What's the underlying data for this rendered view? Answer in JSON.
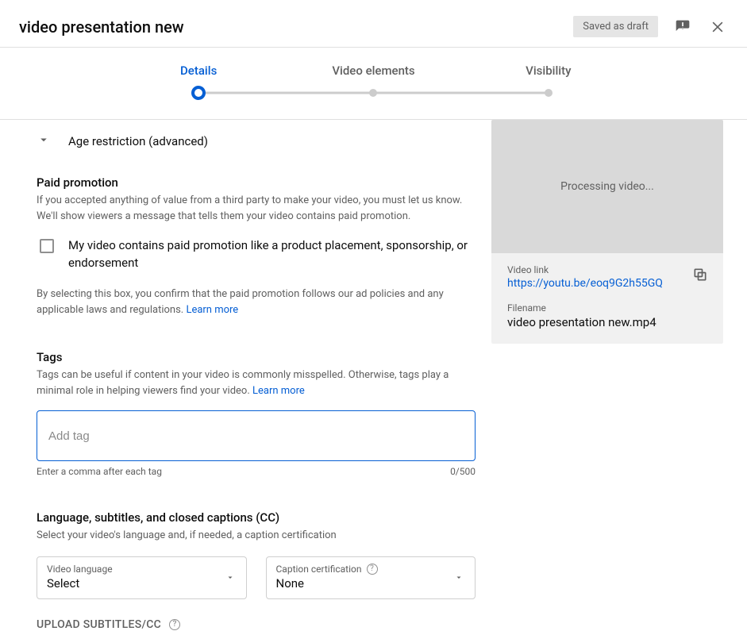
{
  "header": {
    "title": "video presentation new",
    "draft_chip": "Saved as draft"
  },
  "stepper": {
    "steps": [
      {
        "label": "Details"
      },
      {
        "label": "Video elements"
      },
      {
        "label": "Visibility"
      }
    ]
  },
  "age_restriction": {
    "title": "Age restriction (advanced)"
  },
  "paid_promo": {
    "title": "Paid promotion",
    "desc": "If you accepted anything of value from a third party to make your video, you must let us know. We'll show viewers a message that tells them your video contains paid promotion.",
    "checkbox_label": "My video contains paid promotion like a product placement, sponsorship, or endorsement",
    "disclaimer": "By selecting this box, you confirm that the paid promotion follows our ad policies and any applicable laws and regulations. ",
    "learn_more": "Learn more"
  },
  "tags": {
    "title": "Tags",
    "desc": "Tags can be useful if content in your video is commonly misspelled. Otherwise, tags play a minimal role in helping viewers find your video. ",
    "learn_more": "Learn more",
    "placeholder": "Add tag",
    "hint": "Enter a comma after each tag",
    "counter": "0/500"
  },
  "language": {
    "title": "Language, subtitles, and closed captions (CC)",
    "desc": "Select your video's language and, if needed, a caption certification",
    "video_lang_label": "Video language",
    "video_lang_value": "Select",
    "caption_label": "Caption certification",
    "caption_value": "None",
    "upload_btn": "UPLOAD SUBTITLES/CC"
  },
  "side": {
    "processing": "Processing video...",
    "link_label": "Video link",
    "link_value": "https://youtu.be/eoq9G2h55GQ",
    "file_label": "Filename",
    "file_value": "video presentation new.mp4"
  }
}
